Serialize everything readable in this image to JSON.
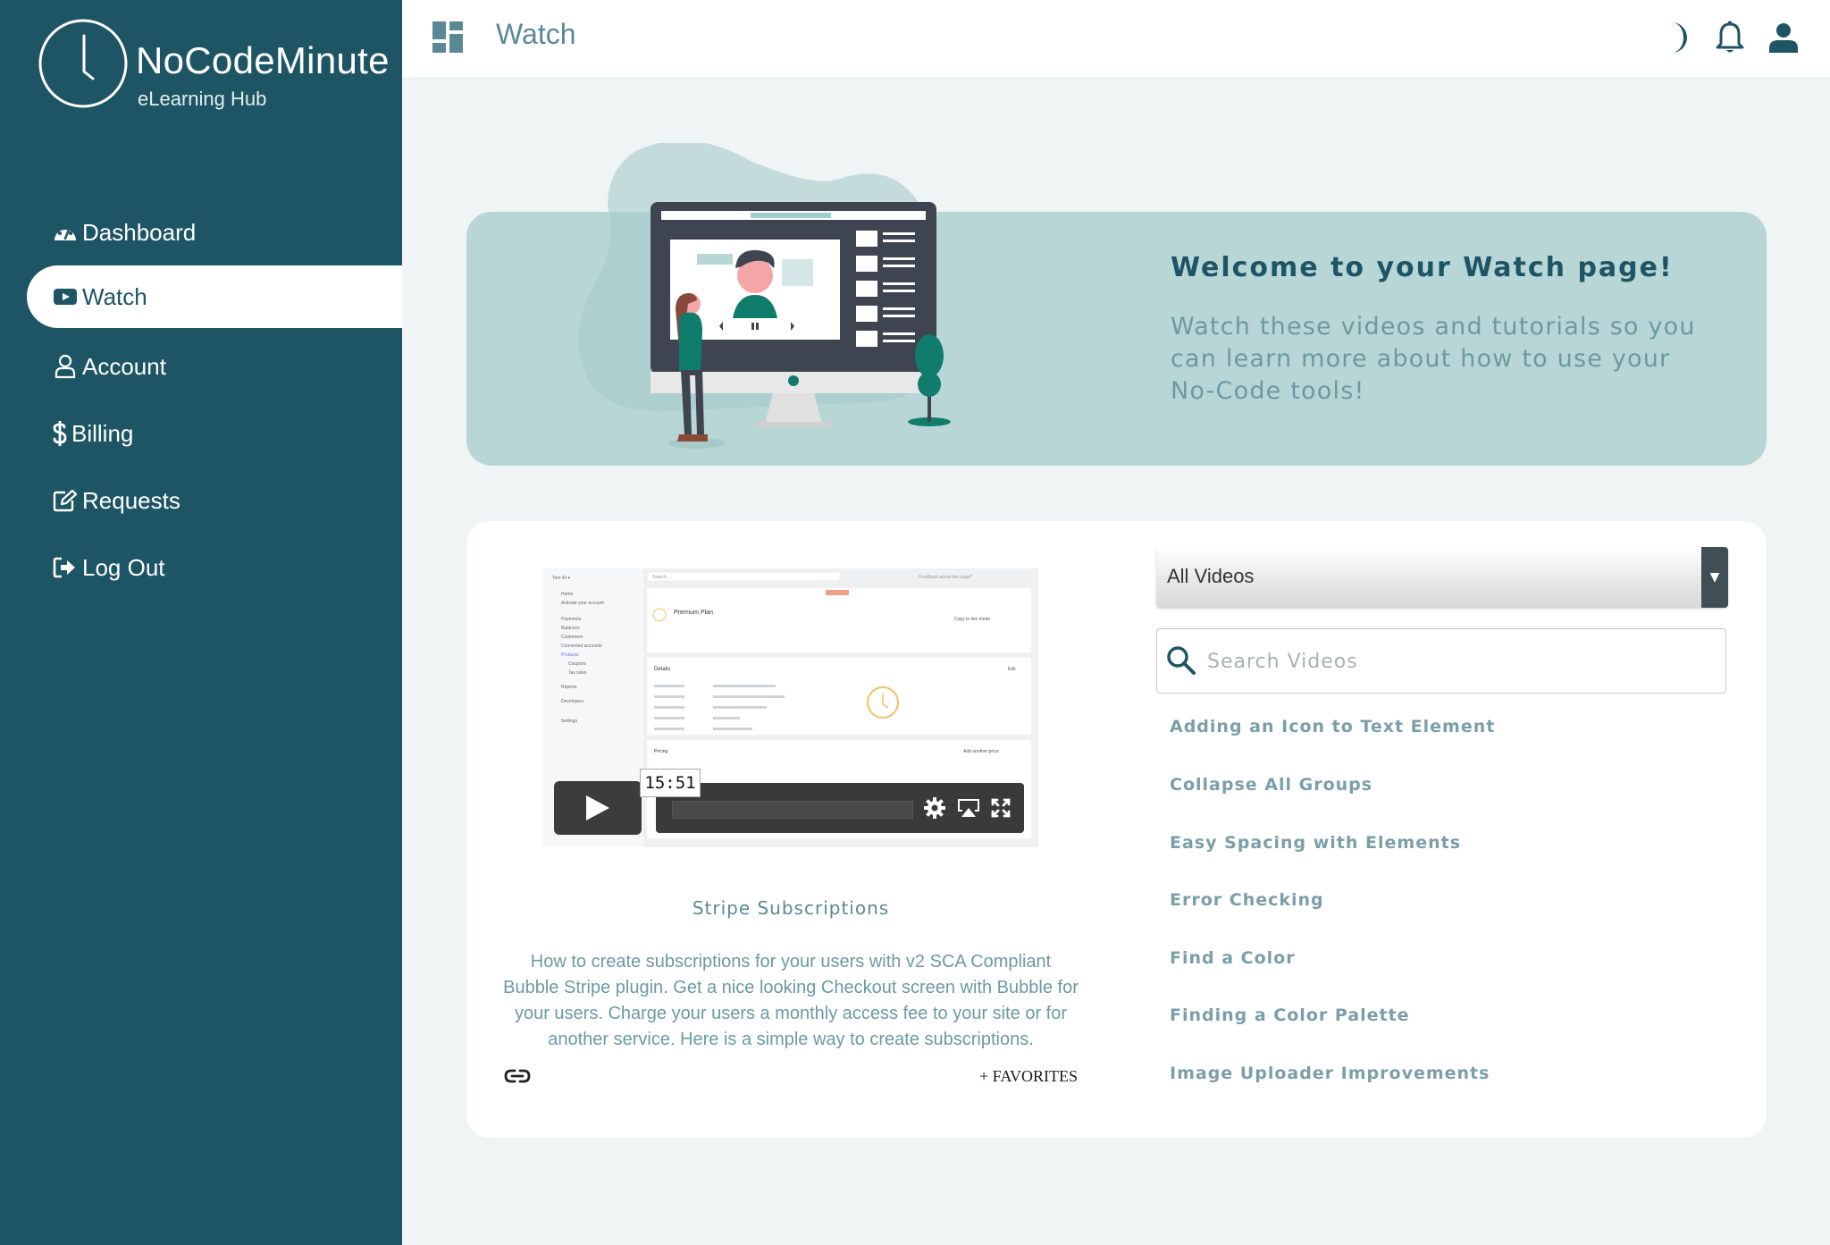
{
  "brand": {
    "name": "NoCodeMinute",
    "subtitle": "eLearning Hub"
  },
  "sidebar": {
    "items": [
      {
        "label": "Dashboard",
        "icon": "dashboard-gauge-icon",
        "active": false
      },
      {
        "label": "Watch",
        "icon": "youtube-play-icon",
        "active": true
      },
      {
        "label": "Account",
        "icon": "user-outline-icon",
        "active": false
      },
      {
        "label": "Billing",
        "icon": "dollar-icon",
        "active": false
      },
      {
        "label": "Requests",
        "icon": "edit-square-icon",
        "active": false
      },
      {
        "label": "Log Out",
        "icon": "sign-out-icon",
        "active": false
      }
    ]
  },
  "topbar": {
    "title": "Watch",
    "icons": [
      "dashboard-grid-icon",
      "moon-icon",
      "bell-icon",
      "user-icon"
    ]
  },
  "banner": {
    "title": "Welcome to your Watch page!",
    "text": "Watch these videos and tutorials so you can learn more about how to use your No-Code tools!"
  },
  "video": {
    "timestamp": "15:51",
    "title": "Stripe Subscriptions",
    "description": "How to create subscriptions for your users with v2 SCA Compliant Bubble Stripe plugin. Get a nice looking Checkout screen with Bubble for your users. Charge your users a monthly access fee to your site or for another service. Here is a simple way to create subscriptions.",
    "favorites_label": "+ FAVORITES",
    "preview_texts": {
      "search": "Search...",
      "plan": "Premium Plan",
      "details": "Details",
      "pricing": "Pricing",
      "feedback": "Feedback about this page?",
      "copy": "Copy to live mode",
      "edit": "Edit",
      "add_price": "Add another price",
      "nav": [
        "Home",
        "Activate your account",
        "Payments",
        "Balances",
        "Customers",
        "Connected accounts",
        "Products",
        "Coupons",
        "Tax rates",
        "Reports",
        "Developers",
        "Settings"
      ]
    }
  },
  "filter": {
    "selected": "All Videos",
    "search_placeholder": "Search Videos"
  },
  "video_list": [
    "Adding an Icon to Text Element",
    "Collapse All Groups",
    "Easy Spacing with Elements",
    "Error Checking",
    "Find a Color",
    "Finding a Color Palette",
    "Image Uploader Improvements"
  ],
  "colors": {
    "sidebar": "#1e5564",
    "accent": "#1e5564",
    "banner": "#b8d6d6",
    "main_bg": "#eff4f4",
    "muted_text": "#6b9aa3"
  }
}
